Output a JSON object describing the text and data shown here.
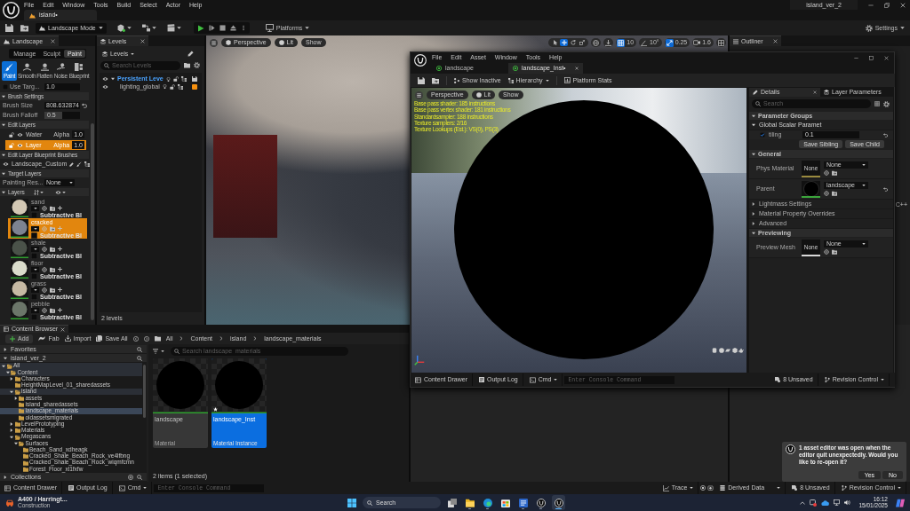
{
  "main_window": {
    "menu": [
      "File",
      "Edit",
      "Window",
      "Tools",
      "Build",
      "Select",
      "Actor",
      "Help"
    ],
    "level_tab": "island•",
    "project": "island_ver_2"
  },
  "toolbar": {
    "mode": "Landscape Mode",
    "platforms": "Platforms",
    "settings": "Settings"
  },
  "landscape_panel": {
    "tab": "Landscape",
    "modes": [
      {
        "label": "Manage",
        "selected": false
      },
      {
        "label": "Sculpt",
        "selected": false
      },
      {
        "label": "Paint",
        "selected": true
      }
    ],
    "tools": [
      {
        "label": "Paint",
        "selected": true
      },
      {
        "label": "Smooth",
        "selected": false
      },
      {
        "label": "Flatten",
        "selected": false
      },
      {
        "label": "Noise",
        "selected": false
      },
      {
        "label": "Blueprint",
        "selected": false
      }
    ],
    "rows": [
      {
        "kind": "check",
        "label": "Use Targ...",
        "checked": false,
        "value": "1.0"
      },
      {
        "kind": "section",
        "label": "Brush Settings",
        "expanded": true
      },
      {
        "kind": "number",
        "label": "Brush Size",
        "value": "808.632874"
      },
      {
        "kind": "slider",
        "label": "Brush Falloff",
        "value": "0.5",
        "level": 0.5
      },
      {
        "kind": "section",
        "label": "Edit Layers",
        "expanded": true
      },
      {
        "kind": "edit_layer",
        "label": "Water",
        "alpha_label": "Alpha",
        "alpha": "1.0",
        "selected": false
      },
      {
        "kind": "edit_layer",
        "label": "Layer",
        "alpha_label": "Alpha",
        "alpha": "1.0",
        "selected": true
      },
      {
        "kind": "section",
        "label": "Edit Layer Blueprint Brushes",
        "expanded": true
      },
      {
        "kind": "brush",
        "label": "Landscape_Custom"
      },
      {
        "kind": "section",
        "label": "Target Layers",
        "expanded": true
      },
      {
        "kind": "dropdown",
        "label": "Painting Res...",
        "value": "None"
      },
      {
        "kind": "layers_section",
        "label": "Layers",
        "expanded": true
      }
    ],
    "target_layers": [
      {
        "name": "sand",
        "color": "#d3c8b4",
        "selected": false,
        "blend_label": "Subtractive Bl",
        "blend_checked": false
      },
      {
        "name": "cracked",
        "color": "#7d8391",
        "selected": true,
        "blend_label": "Subtractive Bl",
        "blend_checked": false
      },
      {
        "name": "shale",
        "color": "#4a5249",
        "selected": false,
        "blend_label": "Subtractive Bl",
        "blend_checked": false
      },
      {
        "name": "floor",
        "color": "#dadccb",
        "selected": false,
        "blend_label": "Subtractive Bl",
        "blend_checked": false
      },
      {
        "name": "grass",
        "color": "#c6b9a3",
        "selected": false,
        "blend_label": "Subtractive Bl",
        "blend_checked": false
      },
      {
        "name": "pebble",
        "color": "#6b7669",
        "selected": false,
        "blend_label": "Subtractive Bl",
        "blend_checked": false
      }
    ]
  },
  "levels_panel": {
    "tab": "Levels",
    "dropdown": "Levels",
    "search_placeholder": "Search Levels",
    "levels": [
      {
        "name": "Persistent Leve",
        "current": true,
        "expanded": true,
        "children": [
          {
            "name": "lighting_global",
            "current": false,
            "color": "#f5900f"
          }
        ]
      }
    ],
    "footer": "2 levels"
  },
  "viewport": {
    "view_buttons": [
      "Perspective",
      "Lit",
      "Show"
    ],
    "transform_tools": [
      {
        "kind": "select",
        "selected": false
      },
      {
        "kind": "move",
        "selected": true
      },
      {
        "kind": "rotate",
        "selected": false
      },
      {
        "kind": "scale",
        "selected": false
      }
    ],
    "snaps": [
      {
        "kind": "grid",
        "value": "10",
        "on": true
      },
      {
        "kind": "rotation",
        "value": "10°",
        "on": false
      },
      {
        "kind": "scale",
        "value": "0.25",
        "on": true
      }
    ],
    "camera_speed": "1.6"
  },
  "outliner": {
    "tab": "Outliner",
    "visible_type": "C++"
  },
  "material_editor": {
    "menu": [
      "File",
      "Edit",
      "Asset",
      "Window",
      "Tools",
      "Help"
    ],
    "tabs": [
      {
        "label": "landscape",
        "selected": false
      },
      {
        "label": "landscape_Inst•",
        "selected": true
      }
    ],
    "toolbar": {
      "show_inactive": "Show Inactive",
      "hierarchy": "Hierarchy",
      "platform_stats": "Platform Stats"
    },
    "viewport": {
      "view_buttons": [
        "Perspective",
        "Lit",
        "Show"
      ],
      "stats": [
        "Base pass shader: 185 instructions",
        "Base pass vertex shader: 181 instructions",
        "Standardsampler: 188 instructions",
        "Texture samplers: 2/16",
        "Texture Lookups (Est.): VS(0), PS(3)"
      ]
    },
    "details": {
      "tabs": [
        {
          "label": "Details",
          "selected": true
        },
        {
          "label": "Layer Parameters",
          "selected": false
        }
      ],
      "search_placeholder": "Search",
      "rows": [
        {
          "kind": "category",
          "label": "Parameter Groups",
          "expanded": true
        },
        {
          "kind": "group",
          "label": "Global Scalar Paramet",
          "expanded": true
        },
        {
          "kind": "param",
          "label": "tiling",
          "checked": true,
          "value": "0.1",
          "modified": true
        },
        {
          "kind": "buttons",
          "buttons": [
            "Save Sibling",
            "Save Child"
          ]
        },
        {
          "kind": "category",
          "label": "General",
          "expanded": true
        },
        {
          "kind": "asset",
          "label": "Phys Material",
          "thumb_label": "None",
          "color": "#9a8a3e",
          "value": "None",
          "modified": false
        },
        {
          "kind": "asset",
          "label": "Parent",
          "color": "#3ba53b",
          "value": "landscape",
          "modified": true
        },
        {
          "kind": "group",
          "label": "Lightmass Settings",
          "expanded": false
        },
        {
          "kind": "group",
          "label": "Material Property Overrides",
          "expanded": false
        },
        {
          "kind": "group",
          "label": "Advanced",
          "expanded": false
        },
        {
          "kind": "category",
          "label": "Previewing",
          "expanded": true
        },
        {
          "kind": "asset",
          "label": "Preview Mesh",
          "thumb_label": "None",
          "color": "#d8d8d8",
          "value": "None",
          "modified": false
        }
      ]
    },
    "status_bar": {
      "content_drawer": "Content Drawer",
      "output_log": "Output Log",
      "cmd": "Cmd",
      "console_placeholder": "Enter Console Command",
      "unsaved": "8 Unsaved",
      "revision_control": "Revision Control"
    }
  },
  "content_browser": {
    "tab": "Content Browser",
    "toolbar": {
      "add": "Add",
      "fab": "Fab",
      "import": "Import",
      "save_all": "Save All"
    },
    "breadcrumbs": [
      "All",
      "Content",
      "island",
      "landscape_materials"
    ],
    "favorites": "Favorites",
    "project": "island_ver_2",
    "tree": [
      {
        "name": "All",
        "expanded": true,
        "selected": false,
        "highlighted": true,
        "children": [
          {
            "name": "Content",
            "expanded": true,
            "selected": false,
            "highlighted": true,
            "children": [
              {
                "name": "Characters",
                "expanded": false,
                "selected": false,
                "highlighted": false
              },
              {
                "name": "HeightMapLevel_01_sharedassets",
                "selected": false,
                "highlighted": false
              },
              {
                "name": "island",
                "expanded": true,
                "selected": false,
                "highlighted": true,
                "children": [
                  {
                    "name": "assets",
                    "expanded": false,
                    "selected": false,
                    "highlighted": false
                  },
                  {
                    "name": "island_sharedassets",
                    "selected": false,
                    "highlighted": false
                  },
                  {
                    "name": "landscape_materials",
                    "selected": true,
                    "highlighted": false
                  },
                  {
                    "name": "oldassetsmigrated",
                    "selected": false,
                    "highlighted": false
                  }
                ]
              },
              {
                "name": "LevelPrototyping",
                "expanded": false,
                "selected": false,
                "highlighted": false
              },
              {
                "name": "Materials",
                "expanded": false,
                "selected": false,
                "highlighted": false
              },
              {
                "name": "Megascans",
                "expanded": true,
                "selected": false,
                "highlighted": false,
                "children": [
                  {
                    "name": "Surfaces",
                    "expanded": true,
                    "selected": false,
                    "highlighted": false,
                    "children": [
                      {
                        "name": "Beach_Sand_xdheagk",
                        "selected": false,
                        "highlighted": false
                      },
                      {
                        "name": "Cracked_Shale_Beach_Rock_ve4lfbng",
                        "selected": false,
                        "highlighted": false
                      },
                      {
                        "name": "Cracked_Shale_Beach_Rock_wiqmfcmn",
                        "selected": false,
                        "highlighted": false
                      },
                      {
                        "name": "Forest_Floor_xl1fxfw",
                        "selected": false,
                        "highlighted": false
                      }
                    ]
                  }
                ]
              }
            ]
          }
        ]
      }
    ],
    "collections": "Collections",
    "search_placeholder": "Search landscape_materials",
    "assets": [
      {
        "name": "landscape",
        "type": "Material",
        "selected": false,
        "modified": false
      },
      {
        "name": "landscape_Inst",
        "type": "Material Instance",
        "selected": true,
        "modified": true
      }
    ],
    "footer": "2 items (1 selected)"
  },
  "status_bar": {
    "content_drawer": "Content Drawer",
    "output_log": "Output Log",
    "cmd": "Cmd",
    "console_placeholder": "Enter Console Command",
    "trace": "Trace",
    "derived_data": "Derived Data",
    "unsaved": "8 Unsaved",
    "revision_control": "Revision Control"
  },
  "notification": {
    "message": "1 asset editor was open when the editor quit unexpectedly. Would you like to re-open it?",
    "buttons": [
      "Yes",
      "No"
    ]
  },
  "taskbar": {
    "news": {
      "title": "A400 / Harringt...",
      "subtitle": "Construction"
    },
    "search_placeholder": "Search",
    "apps": [
      {
        "kind": "task-view",
        "running": false,
        "active": false
      },
      {
        "kind": "explorer",
        "running": true,
        "active": false
      },
      {
        "kind": "edge",
        "running": true,
        "active": false
      },
      {
        "kind": "store",
        "running": false,
        "active": false
      },
      {
        "kind": "word",
        "running": true,
        "active": false
      },
      {
        "kind": "unreal",
        "running": true,
        "active": false
      },
      {
        "kind": "unreal",
        "running": true,
        "active": true
      }
    ],
    "time": "16:12",
    "date": "15/01/2025"
  }
}
